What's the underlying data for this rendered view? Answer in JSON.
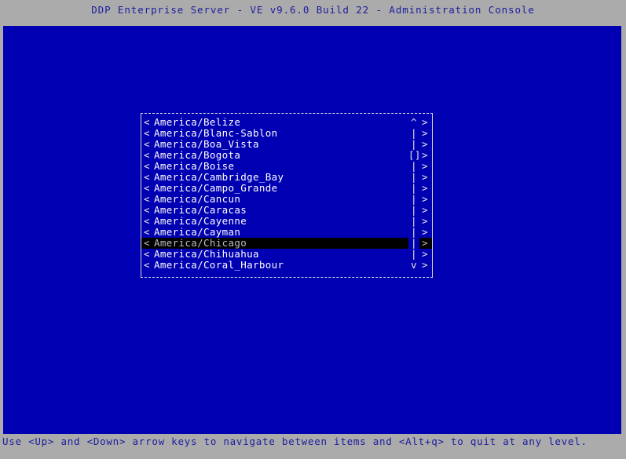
{
  "window": {
    "title": "DDP Enterprise Server - VE v9.6.0 Build 22 - Administration Console",
    "frame_color": "#ababab",
    "terminal_background": "#0000b2",
    "text_color": "#1c1c9e"
  },
  "dialog": {
    "name": "timezone-selection-list",
    "left_bracket": "<",
    "right_bracket": ">",
    "scroll_up_arrow": "^",
    "scroll_down_arrow": "v",
    "scroll_track": "|",
    "scroll_thumb": "[]",
    "selected_index": 11,
    "selected_background": "#000000",
    "items": [
      {
        "label": "America/Belize",
        "scroll": "^"
      },
      {
        "label": "America/Blanc-Sablon",
        "scroll": "|"
      },
      {
        "label": "America/Boa_Vista",
        "scroll": "|"
      },
      {
        "label": "America/Bogota",
        "scroll": "[]"
      },
      {
        "label": "America/Boise",
        "scroll": "|"
      },
      {
        "label": "America/Cambridge_Bay",
        "scroll": "|"
      },
      {
        "label": "America/Campo_Grande",
        "scroll": "|"
      },
      {
        "label": "America/Cancun",
        "scroll": "|"
      },
      {
        "label": "America/Caracas",
        "scroll": "|"
      },
      {
        "label": "America/Cayenne",
        "scroll": "|"
      },
      {
        "label": "America/Cayman",
        "scroll": "|"
      },
      {
        "label": "America/Chicago",
        "scroll": "|"
      },
      {
        "label": "America/Chihuahua",
        "scroll": "|"
      },
      {
        "label": "America/Coral_Harbour",
        "scroll": "v"
      }
    ]
  },
  "statusbar": {
    "hint": "Use <Up> and <Down> arrow keys to navigate between items and <Alt+q> to quit at any level."
  }
}
